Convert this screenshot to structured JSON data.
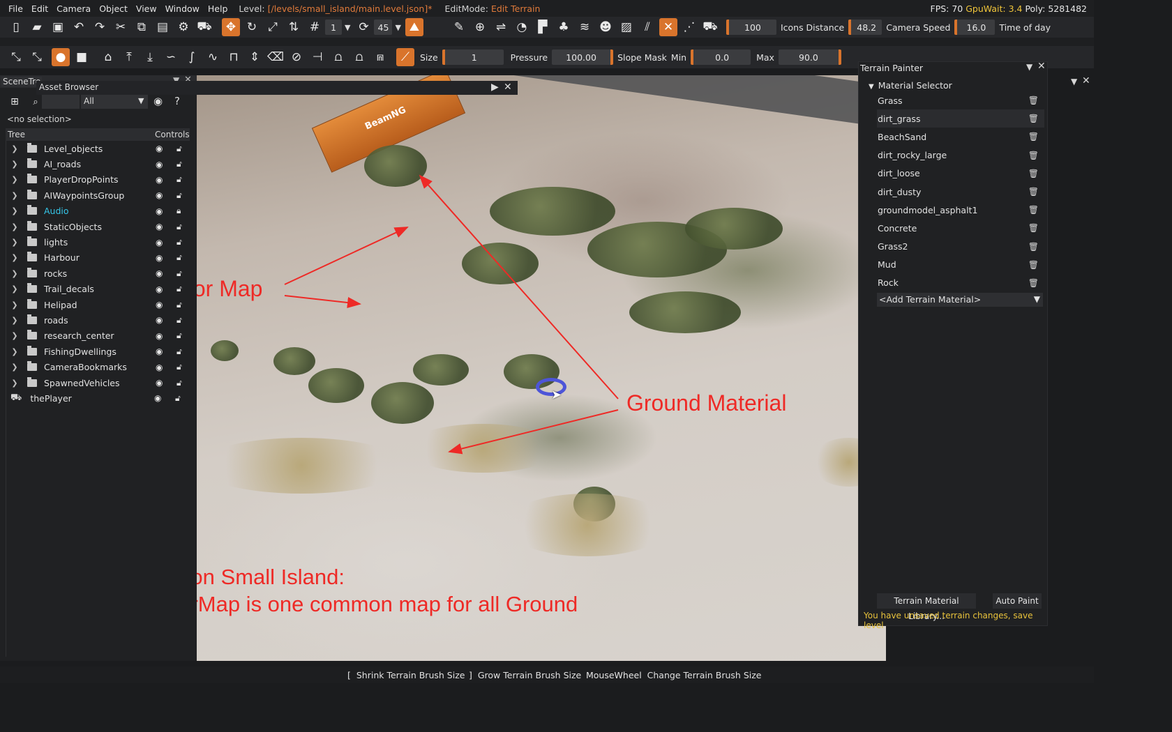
{
  "menubar": {
    "items": [
      "File",
      "Edit",
      "Camera",
      "Object",
      "View",
      "Window",
      "Help"
    ],
    "level_label": "Level:",
    "level_path": "[/levels/small_island/main.level.json]*",
    "editmode_label": "EditMode:",
    "editmode_value": "Edit Terrain",
    "fps": "FPS: 70",
    "gpuwait": "GpuWait: 3.4",
    "poly": "Poly: 5281482"
  },
  "toolbar1": {
    "grid_value": "1",
    "rotate_snap": "45",
    "icons_field": "100",
    "icons_distance_label": "Icons Distance",
    "icons_distance_value": "48.2",
    "camera_speed_label": "Camera Speed",
    "camera_speed_value": "16.0",
    "time_of_day_label": "Time of day"
  },
  "toolbar2": {
    "size_label": "Size",
    "size_value": "1",
    "pressure_label": "Pressure",
    "pressure_value": "100.00",
    "slope_mask_label": "Slope Mask",
    "min_label": "Min",
    "min_value": "0.0",
    "max_label": "Max",
    "max_value": "90.0"
  },
  "scene_tree": {
    "tab_label": "SceneTre",
    "asset_browser_title": "Asset Browser",
    "filter_value": "All",
    "no_selection": "<no selection>",
    "header_tree": "Tree",
    "header_controls": "Controls",
    "items": [
      {
        "label": "Level_objects"
      },
      {
        "label": "AI_roads"
      },
      {
        "label": "PlayerDropPoints"
      },
      {
        "label": "AIWaypointsGroup"
      },
      {
        "label": "Audio"
      },
      {
        "label": "StaticObjects"
      },
      {
        "label": "lights"
      },
      {
        "label": "Harbour"
      },
      {
        "label": "rocks"
      },
      {
        "label": "Trail_decals"
      },
      {
        "label": "Helipad"
      },
      {
        "label": "roads"
      },
      {
        "label": "research_center"
      },
      {
        "label": "FishingDwellings"
      },
      {
        "label": "CameraBookmarks"
      },
      {
        "label": "SpawnedVehicles"
      }
    ],
    "player_item": "thePlayer"
  },
  "terrain_painter": {
    "title": "Terrain Painter",
    "section": "Material Selector",
    "materials": [
      "Grass",
      "dirt_grass",
      "BeachSand",
      "dirt_rocky_large",
      "dirt_loose",
      "dirt_dusty",
      "groundmodel_asphalt1",
      "Concrete",
      "Grass2",
      "Mud",
      "Rock"
    ],
    "selected_material": "dirt_grass",
    "add_material": "<Add Terrain Material>",
    "library_button": "Terrain Material Library...",
    "autopaint_button": "Auto Paint",
    "unsaved_message": "You have unsaved terrain changes, save level"
  },
  "viewport": {
    "container_text": "BeamNG",
    "annotation_base": "Base Color Map",
    "annotation_ground": "Ground Material",
    "annotation_note_line1": "PBR situation on Small Island:",
    "annotation_note_line2": "The BaseColorMap is one common map for all Ground Materials.",
    "annotation_color": "#ee2a26",
    "brush_color": "#4d55d8"
  },
  "statusbar": {
    "hints": [
      {
        "key": "[",
        "text": "Shrink Terrain Brush Size"
      },
      {
        "key": "]",
        "text": "Grow Terrain Brush Size"
      },
      {
        "key": "MouseWheel",
        "text": "Change Terrain Brush Size"
      }
    ]
  },
  "colors": {
    "accent_orange": "#d9742c",
    "audio_cyan": "#35c6e8",
    "warning_yellow": "#e8c23b",
    "level_path_orange": "#e07a3a"
  }
}
